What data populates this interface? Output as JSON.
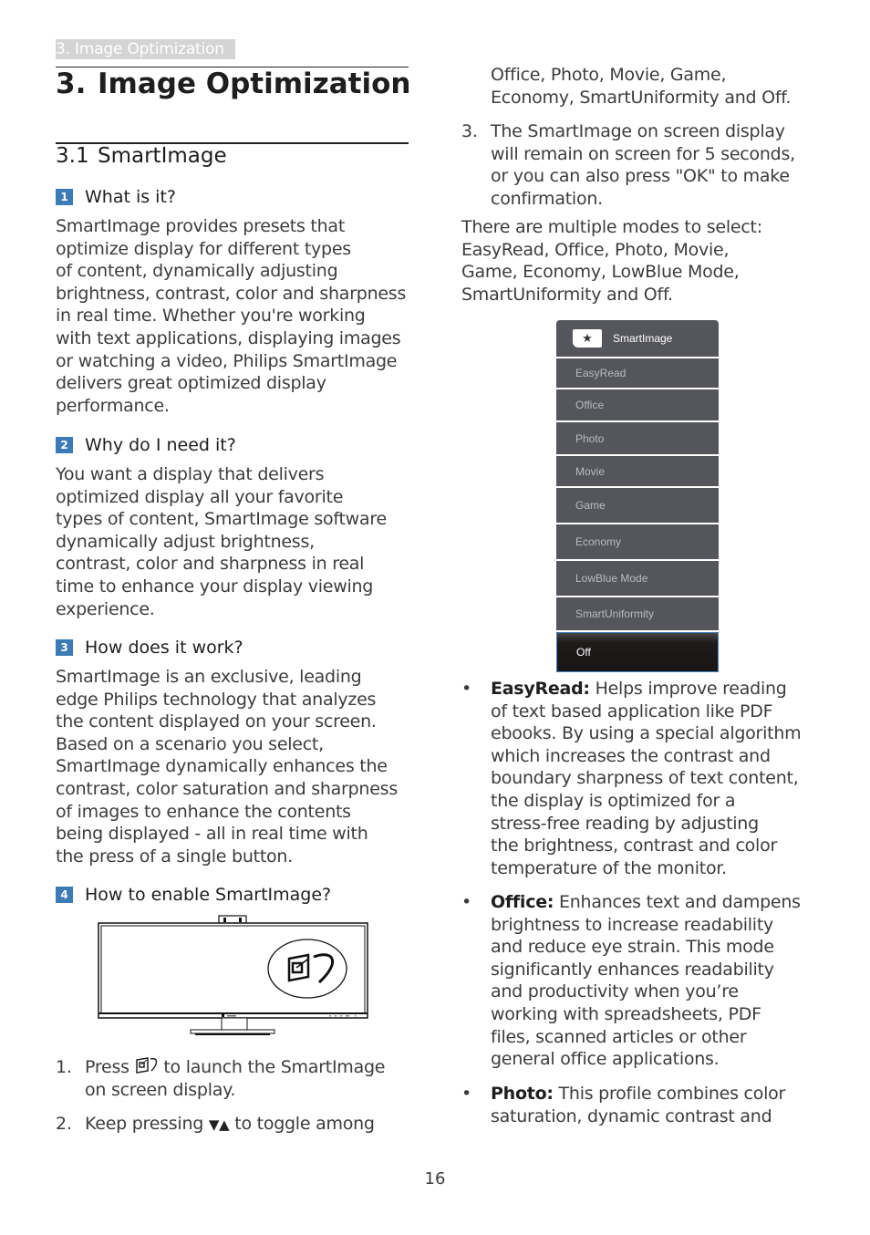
{
  "running_header": "3. Image Optimization",
  "chapter": {
    "number": "3.",
    "title": "Image Optimization"
  },
  "section": {
    "number": "3.1",
    "title": "SmartImage"
  },
  "questions": [
    {
      "badge": "1",
      "title": "What is it?",
      "lines": [
        "SmartImage provides presets that",
        "optimize display for different types",
        "of content, dynamically adjusting",
        "brightness, contrast, color and sharpness",
        "in real time. Whether you're working",
        "with text applications, displaying images",
        "or watching a video, Philips SmartImage",
        "delivers great optimized display",
        "performance."
      ]
    },
    {
      "badge": "2",
      "title": "Why do I need it?",
      "lines": [
        "You want a display that delivers",
        "optimized display all your favorite",
        "types of content, SmartImage software",
        "dynamically adjust brightness,",
        "contrast, color and sharpness in real",
        "time to enhance your display viewing",
        "experience."
      ]
    },
    {
      "badge": "3",
      "title": "How does it work?",
      "lines": [
        "SmartImage is an exclusive, leading",
        "edge Philips technology that analyzes",
        "the content displayed on your screen.",
        "Based on a scenario you select,",
        "SmartImage dynamically enhances the",
        "contrast, color saturation and sharpness",
        "of images to enhance the contents",
        "being displayed - all in real time with",
        "the press of a single button."
      ]
    },
    {
      "badge": "4",
      "title": "How to enable SmartImage?"
    }
  ],
  "steps": {
    "s1": {
      "n": "1.",
      "pre": "Press",
      "post": "to launch the SmartImage",
      "line2": "on screen display."
    },
    "s2": {
      "n": "2.",
      "pre": "Keep pressing",
      "arrows": "▼▲",
      "post": "to toggle among",
      "cont1": "Office, Photo, Movie, Game,",
      "cont2": "Economy, SmartUniformity and Off."
    },
    "s3": {
      "n": "3.",
      "lines": [
        "The SmartImage on screen display",
        "will remain on screen for 5 seconds,",
        "or you can also press \"OK\" to make",
        "confirmation."
      ]
    }
  },
  "modes_intro": [
    "There are multiple modes to select:",
    "EasyRead, Office, Photo, Movie,",
    "Game, Economy, LowBlue Mode,",
    "SmartUniformity and Off."
  ],
  "osd": {
    "title": "SmartImage",
    "items": [
      "EasyRead",
      "Office",
      "Photo",
      "Movie",
      "Game",
      "Economy",
      "LowBlue Mode",
      "SmartUniformity",
      "Off"
    ],
    "selected": "Off"
  },
  "bullets": [
    {
      "term": "EasyRead:",
      "first": "Helps improve reading",
      "lines": [
        "of text based application like PDF",
        "ebooks. By using a special algorithm",
        "which increases the contrast and",
        "boundary sharpness of text content,",
        "the display is optimized for a",
        "stress-free reading by adjusting",
        "the brightness, contrast and color",
        "temperature of the monitor."
      ]
    },
    {
      "term": "Office:",
      "first": "Enhances text and dampens",
      "lines": [
        "brightness to increase readability",
        "and reduce eye strain. This mode",
        "significantly enhances readability",
        "and productivity when you’re",
        "working with spreadsheets, PDF",
        "files, scanned articles or other",
        "general office applications."
      ]
    },
    {
      "term": "Photo:",
      "first": "This profile combines color",
      "lines": [
        "saturation, dynamic contrast and"
      ]
    }
  ],
  "bullet_char": "•",
  "page_number": "16",
  "colors": {
    "badge": "#3d7bb6",
    "osd_bg": "#55565b",
    "osd_selected_border": "#3e7fc2",
    "running_header_bg": "#d4d4d4"
  }
}
